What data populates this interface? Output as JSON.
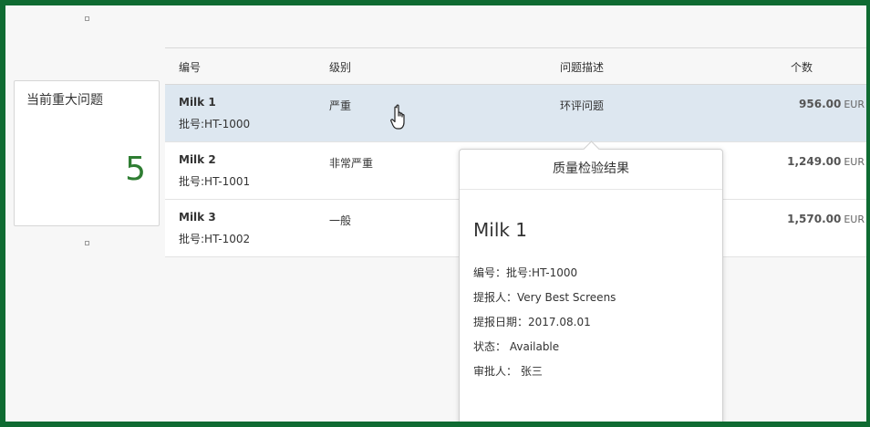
{
  "tile": {
    "title": "当前重大问题",
    "value": "5",
    "value_color": "#2e7d32"
  },
  "table": {
    "headers": {
      "id": "编号",
      "level": "级别",
      "description": "问题描述",
      "count": "个数"
    },
    "rows": [
      {
        "name": "Milk 1",
        "batch": "批号:HT-1000",
        "level": "严重",
        "description": "环评问题",
        "amount": "956.00",
        "currency": "EUR"
      },
      {
        "name": "Milk 2",
        "batch": "批号:HT-1001",
        "level": "非常严重",
        "description": "",
        "amount": "1,249.00",
        "currency": "EUR"
      },
      {
        "name": "Milk 3",
        "batch": "批号:HT-1002",
        "level": "一般",
        "description": "",
        "amount": "1,570.00",
        "currency": "EUR"
      }
    ]
  },
  "popover": {
    "header": "质量检验结果",
    "title": "Milk 1",
    "fields": [
      {
        "label": "编号：",
        "value": "批号:HT-1000"
      },
      {
        "label": "提报人：",
        "value": "Very Best Screens"
      },
      {
        "label": "提报日期：",
        "value": "2017.08.01"
      },
      {
        "label": "状态：",
        "value": " Available"
      },
      {
        "label": "审批人：",
        "value": " 张三"
      }
    ]
  },
  "colors": {
    "frame": "#0f6b32",
    "selected_row": "#dde7f0",
    "accent_value": "#2e7d32"
  },
  "icons": {
    "cursor": "hand-pointer-icon"
  }
}
